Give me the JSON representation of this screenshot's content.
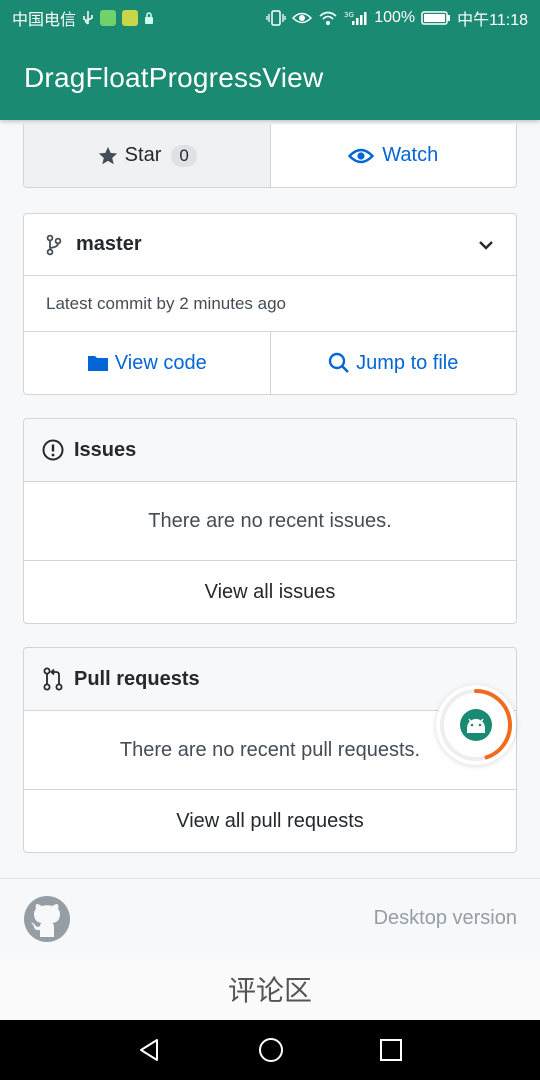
{
  "status_bar": {
    "carrier": "中国电信",
    "battery": "100%",
    "time": "中午11:18",
    "network": "3G"
  },
  "app_bar": {
    "title": "DragFloatProgressView"
  },
  "repo_actions": {
    "star_label": "Star",
    "star_count": "0",
    "watch_label": "Watch"
  },
  "branch": {
    "name": "master",
    "latest_commit": "Latest commit by 2 minutes ago",
    "view_code_label": "View code",
    "jump_to_file_label": "Jump to file"
  },
  "issues": {
    "title": "Issues",
    "empty_text": "There are no recent issues.",
    "view_all_label": "View all issues"
  },
  "pull_requests": {
    "title": "Pull requests",
    "empty_text": "There are no recent pull requests.",
    "view_all_label": "View all pull requests"
  },
  "float_progress": {
    "progress": 0.45,
    "color": "#f26b1d"
  },
  "footer": {
    "desktop_version_label": "Desktop version"
  },
  "comment_area": {
    "label": "评论区"
  },
  "colors": {
    "primary": "#1b8a73",
    "link": "#0366d6",
    "progress": "#f26b1d"
  }
}
